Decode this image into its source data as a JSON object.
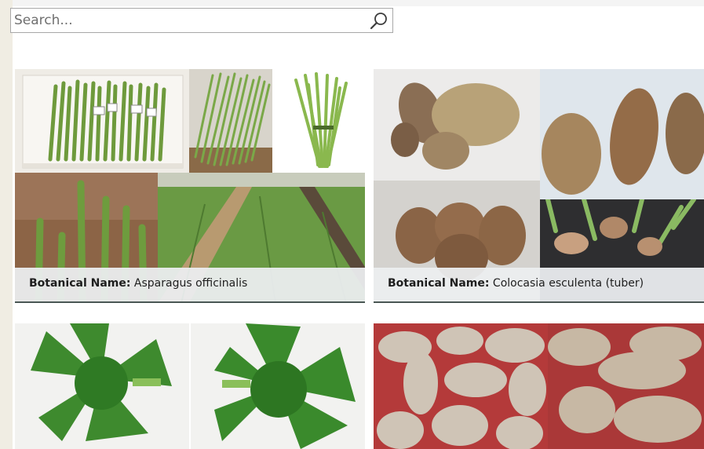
{
  "search": {
    "placeholder": "Search...",
    "value": ""
  },
  "icons": {
    "search": "search-icon"
  },
  "cards": [
    {
      "caption_label": "Botanical Name:",
      "caption_value": "Asparagus officinalis"
    },
    {
      "caption_label": "Botanical Name:",
      "caption_value": "Colocasia esculenta (tuber)"
    },
    {
      "caption_label": "",
      "caption_value": ""
    },
    {
      "caption_label": "",
      "caption_value": ""
    }
  ]
}
